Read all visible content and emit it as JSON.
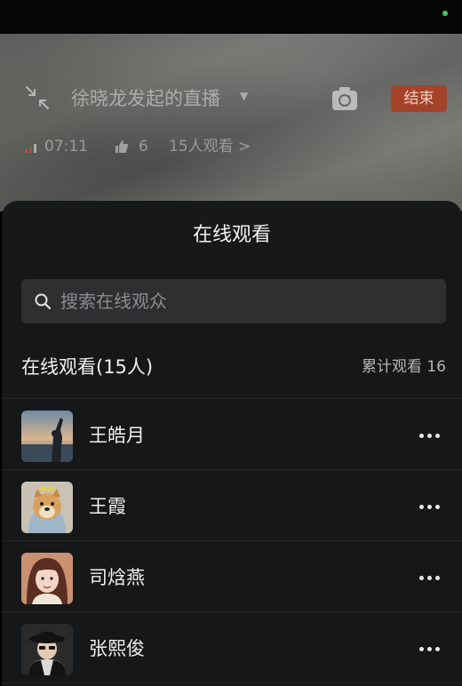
{
  "live": {
    "title": "徐晓龙发起的直播",
    "end_label": "结束",
    "duration": "07:11",
    "likes": "6",
    "viewers": "15人观看 >"
  },
  "sheet": {
    "title": "在线观看",
    "search_placeholder": "搜索在线观众",
    "list_title": "在线观看(15人)",
    "cumulative": "累计观看 16",
    "viewers": [
      {
        "name": "王皓月",
        "avatar": "sunset-photo"
      },
      {
        "name": "王霞",
        "avatar": "dog-photo"
      },
      {
        "name": "司焓燕",
        "avatar": "girl-photo"
      },
      {
        "name": "张熙俊",
        "avatar": "person-hat-photo"
      }
    ]
  },
  "colors": {
    "end_button": "#a5432a",
    "sheet_bg": "#161718",
    "search_bg": "#2e2f31"
  }
}
